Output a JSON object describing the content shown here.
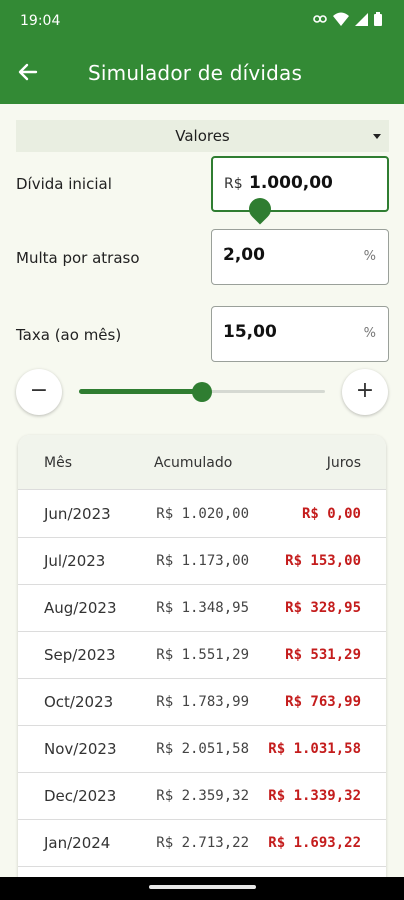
{
  "status": {
    "time": "19:04"
  },
  "appbar": {
    "title": "Simulador de dívidas"
  },
  "dropdown": {
    "label": "Valores"
  },
  "fields": {
    "divida": {
      "label": "Dívida inicial",
      "prefix": "R$",
      "value": "1.000,00"
    },
    "multa": {
      "label": "Multa por atraso",
      "value": "2,00",
      "suffix": "%"
    },
    "taxa": {
      "label": "Taxa (ao mês)",
      "value": "15,00",
      "suffix": "%"
    }
  },
  "slider": {
    "minus": "−",
    "plus": "+",
    "fraction": 0.5
  },
  "table": {
    "headers": {
      "month": "Mês",
      "accumulated": "Acumulado",
      "interest": "Juros"
    },
    "rows": [
      {
        "month": "Jun/2023",
        "accumulated": "R$ 1.020,00",
        "interest": "R$ 0,00"
      },
      {
        "month": "Jul/2023",
        "accumulated": "R$ 1.173,00",
        "interest": "R$ 153,00"
      },
      {
        "month": "Aug/2023",
        "accumulated": "R$ 1.348,95",
        "interest": "R$ 328,95"
      },
      {
        "month": "Sep/2023",
        "accumulated": "R$ 1.551,29",
        "interest": "R$ 531,29"
      },
      {
        "month": "Oct/2023",
        "accumulated": "R$ 1.783,99",
        "interest": "R$ 763,99"
      },
      {
        "month": "Nov/2023",
        "accumulated": "R$ 2.051,58",
        "interest": "R$ 1.031,58"
      },
      {
        "month": "Dec/2023",
        "accumulated": "R$ 2.359,32",
        "interest": "R$ 1.339,32"
      },
      {
        "month": "Jan/2024",
        "accumulated": "R$ 2.713,22",
        "interest": "R$ 1.693,22"
      }
    ]
  }
}
